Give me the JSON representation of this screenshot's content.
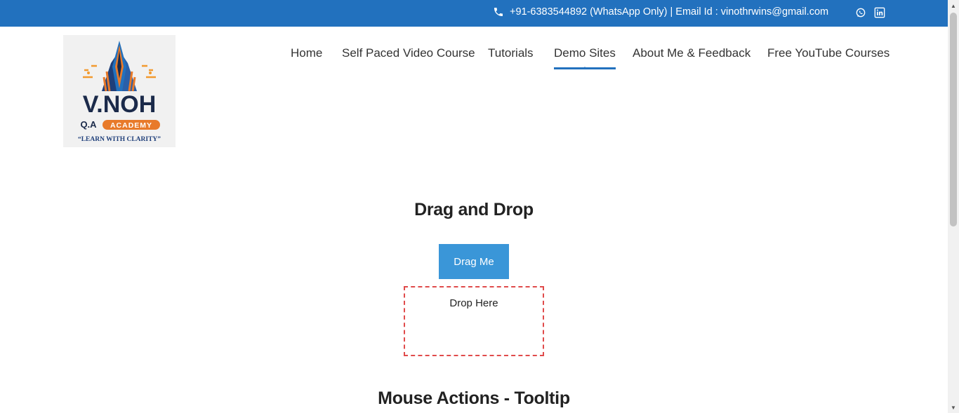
{
  "topbar": {
    "contact_text": "+91-6383544892 (WhatsApp Only)  |  Email Id : vinothrwins@gmail.com",
    "background": "#2271be",
    "icons": [
      "phone-icon",
      "whatsapp-icon",
      "linkedin-icon"
    ]
  },
  "logo": {
    "brand": "V.NOH",
    "subtitle": "Q.A",
    "academy": "ACADEMY",
    "tagline": "“LEARN WITH CLARITY”"
  },
  "nav": {
    "items": [
      {
        "label": "Home"
      },
      {
        "label": "Self Paced Video Course"
      },
      {
        "label": "Tutorials"
      },
      {
        "label": "Demo Sites",
        "active": true
      },
      {
        "label": "About Me & Feedback"
      },
      {
        "label": "Free YouTube Courses"
      }
    ]
  },
  "main": {
    "drag_heading": "Drag and Drop",
    "drag_button": "Drag Me",
    "drop_zone": "Drop Here",
    "tooltip_heading": "Mouse Actions - Tooltip"
  },
  "colors": {
    "accent": "#2271be",
    "drag_button": "#3a96d8",
    "drop_border": "#e04b4b"
  }
}
